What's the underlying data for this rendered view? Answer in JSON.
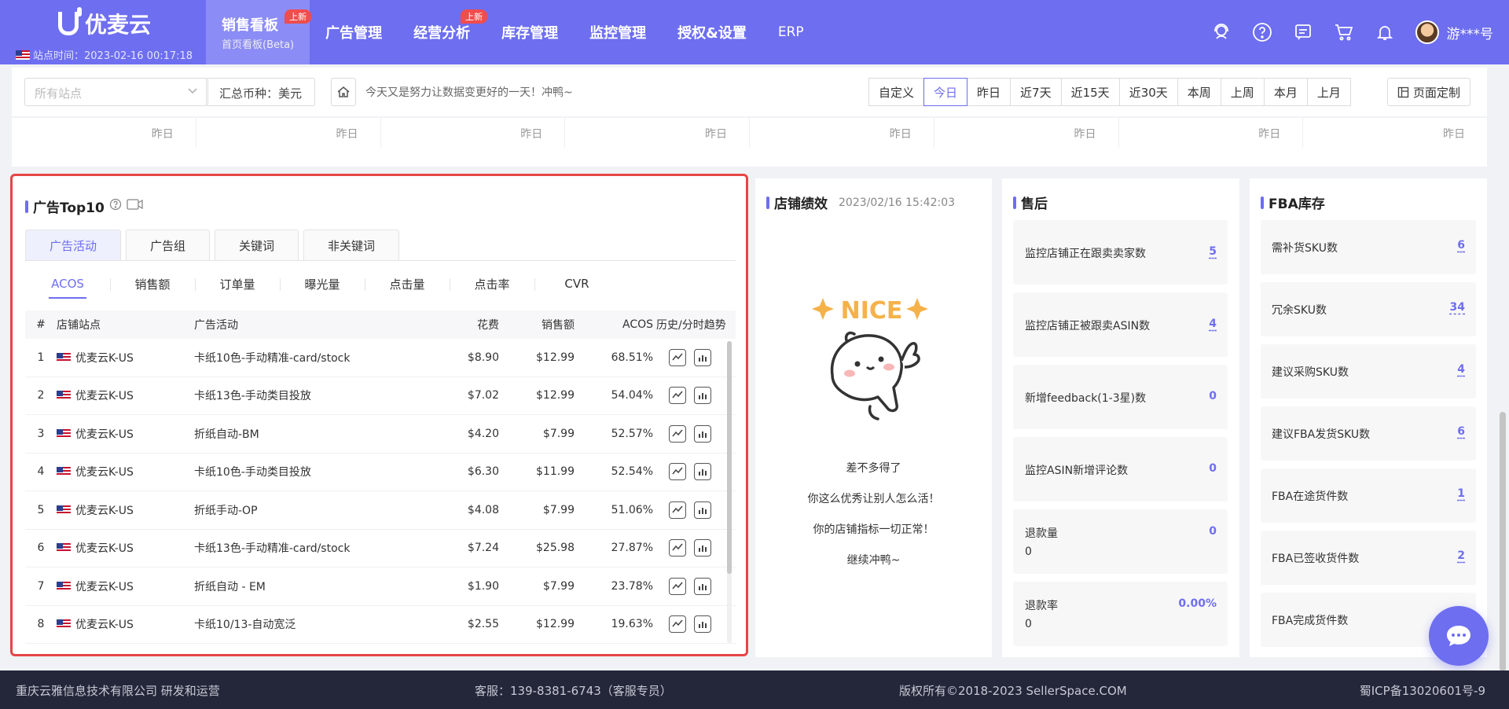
{
  "brand": {
    "name": "优麦云",
    "station_time": "站点时间：2023-02-16 00:17:18"
  },
  "nav": [
    {
      "label": "销售看板",
      "sub": "首页看板(Beta)",
      "badge": "上新",
      "active": true
    },
    {
      "label": "广告管理"
    },
    {
      "label": "经营分析",
      "badge": "上新"
    },
    {
      "label": "库存管理"
    },
    {
      "label": "监控管理"
    },
    {
      "label": "授权&设置"
    },
    {
      "label": "ERP"
    }
  ],
  "user": {
    "name": "游***号"
  },
  "filter": {
    "site_placeholder": "所有站点",
    "currency": "汇总币种：美元",
    "motto": "今天又是努力让数据变更好的一天！冲鸭~",
    "ranges": [
      "自定义",
      "今日",
      "昨日",
      "近7天",
      "近15天",
      "近30天",
      "本周",
      "上周",
      "本月",
      "上月"
    ],
    "active_range": "今日",
    "customize": "页面定制"
  },
  "yesterday_label": "昨日",
  "ads_top10": {
    "title": "广告Top10",
    "tabs": [
      "广告活动",
      "广告组",
      "关键词",
      "非关键词"
    ],
    "metrics": [
      "ACOS",
      "销售额",
      "订单量",
      "曝光量",
      "点击量",
      "点击率",
      "CVR"
    ],
    "headers": {
      "n": "#",
      "store": "店铺站点",
      "campaign": "广告活动",
      "cost": "花费",
      "sales": "销售额",
      "acos": "ACOS",
      "trend": "历史/分时趋势"
    },
    "rows": [
      {
        "n": "1",
        "store": "优麦云K-US",
        "campaign": "卡纸10色-手动精准-card/stock",
        "cost": "$8.90",
        "sales": "$12.99",
        "acos": "68.51%"
      },
      {
        "n": "2",
        "store": "优麦云K-US",
        "campaign": "卡纸13色-手动类目投放",
        "cost": "$7.02",
        "sales": "$12.99",
        "acos": "54.04%"
      },
      {
        "n": "3",
        "store": "优麦云K-US",
        "campaign": "折纸自动-BM",
        "cost": "$4.20",
        "sales": "$7.99",
        "acos": "52.57%"
      },
      {
        "n": "4",
        "store": "优麦云K-US",
        "campaign": "卡纸10色-手动类目投放",
        "cost": "$6.30",
        "sales": "$11.99",
        "acos": "52.54%"
      },
      {
        "n": "5",
        "store": "优麦云K-US",
        "campaign": "折纸手动-OP",
        "cost": "$4.08",
        "sales": "$7.99",
        "acos": "51.06%"
      },
      {
        "n": "6",
        "store": "优麦云K-US",
        "campaign": "卡纸13色-手动精准-card/stock",
        "cost": "$7.24",
        "sales": "$25.98",
        "acos": "27.87%"
      },
      {
        "n": "7",
        "store": "优麦云K-US",
        "campaign": "折纸自动 - EM",
        "cost": "$1.90",
        "sales": "$7.99",
        "acos": "23.78%"
      },
      {
        "n": "8",
        "store": "优麦云K-US",
        "campaign": "卡纸10/13-自动宽泛",
        "cost": "$2.55",
        "sales": "$12.99",
        "acos": "19.63%"
      }
    ]
  },
  "shop": {
    "title": "店铺绩效",
    "time": "2023/02/16 15:42:03",
    "nice": "NICE",
    "messages": [
      "差不多得了",
      "你这么优秀让别人怎么活！",
      "你的店铺指标一切正常！",
      "继续冲鸭~"
    ]
  },
  "after_sales": {
    "title": "售后",
    "cards": [
      {
        "label": "监控店铺正在跟卖卖家数",
        "value": "5"
      },
      {
        "label": "监控店铺正被跟卖ASIN数",
        "value": "4"
      },
      {
        "label": "新增feedback(1-3星)数",
        "value": "0"
      },
      {
        "label": "监控ASIN新增评论数",
        "value": "0"
      },
      {
        "label": "退款量",
        "value": "0",
        "sub": "0"
      },
      {
        "label": "退款率",
        "value": "0.00%",
        "sub": "0"
      }
    ]
  },
  "fba": {
    "title": "FBA库存",
    "cards": [
      {
        "label": "需补货SKU数",
        "value": "6"
      },
      {
        "label": "冗余SKU数",
        "value": "34"
      },
      {
        "label": "建议采购SKU数",
        "value": "4"
      },
      {
        "label": "建议FBA发货SKU数",
        "value": "6"
      },
      {
        "label": "FBA在途货件数",
        "value": "1"
      },
      {
        "label": "FBA已签收货件数",
        "value": "2"
      },
      {
        "label": "FBA完成货件数",
        "value": ""
      }
    ]
  },
  "footer": {
    "company": "重庆云雅信息技术有限公司 研发和运营",
    "service": "客服：139-8381-6743（客服专员）",
    "copyright": "版权所有©2018-2023 SellerSpace.COM",
    "icp": "蜀ICP备13020601号-9"
  }
}
